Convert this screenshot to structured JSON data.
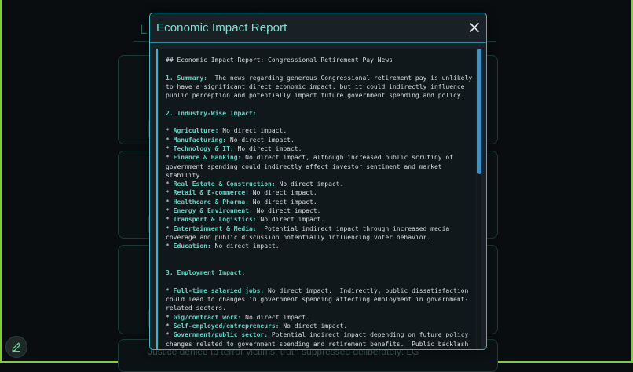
{
  "background": {
    "heading": "L",
    "footer_text": "Justice denied to terror victims, truth suppressed deliberately: LG"
  },
  "fab": {
    "icon": "pencil-icon"
  },
  "modal": {
    "title": "Economic Impact Report",
    "close_icon": "close-icon",
    "report": {
      "heading": "## Economic Impact Report: Congressional Retirement Pay News",
      "summary_label": "1. Summary:",
      "summary_text": "  The news regarding generous Congressional retirement pay is unlikely to have a significant direct economic impact, but it could indirectly influence public perception and potentially impact future government spending and policy.",
      "industry_heading": "2. Industry-Wise Impact:",
      "industries": [
        {
          "label": "Agriculture:",
          "text": " No direct impact."
        },
        {
          "label": "Manufacturing:",
          "text": " No direct impact."
        },
        {
          "label": "Technology & IT:",
          "text": " No direct impact."
        },
        {
          "label": "Finance & Banking:",
          "text": " No direct impact, although increased public scrutiny of government spending could indirectly affect investor sentiment and market stability."
        },
        {
          "label": "Real Estate & Construction:",
          "text": " No direct impact."
        },
        {
          "label": "Retail & E-commerce:",
          "text": " No direct impact."
        },
        {
          "label": "Healthcare & Pharma:",
          "text": " No direct impact."
        },
        {
          "label": "Energy & Environment:",
          "text": " No direct impact."
        },
        {
          "label": "Transport & Logistics:",
          "text": " No direct impact."
        },
        {
          "label": "Entertainment & Media:",
          "text": "  Potential indirect impact through increased media coverage and public discussion potentially influencing voter behavior."
        },
        {
          "label": "Education:",
          "text": " No direct impact."
        }
      ],
      "employment_heading": "3. Employment Impact:",
      "employment": [
        {
          "label": "Full-time salaried jobs:",
          "text": " No direct impact.  Indirectly, public dissatisfaction could lead to changes in government spending affecting employment in government-related sectors."
        },
        {
          "label": "Gig/contract work:",
          "text": " No direct impact."
        },
        {
          "label": "Self-employed/entrepreneurs:",
          "text": " No direct impact."
        },
        {
          "label": "Government/public sector:",
          "text": " Potential indirect impact depending on future policy changes related to government spending and retirement benefits.  Public backlash could lead to budget cuts."
        }
      ]
    }
  }
}
